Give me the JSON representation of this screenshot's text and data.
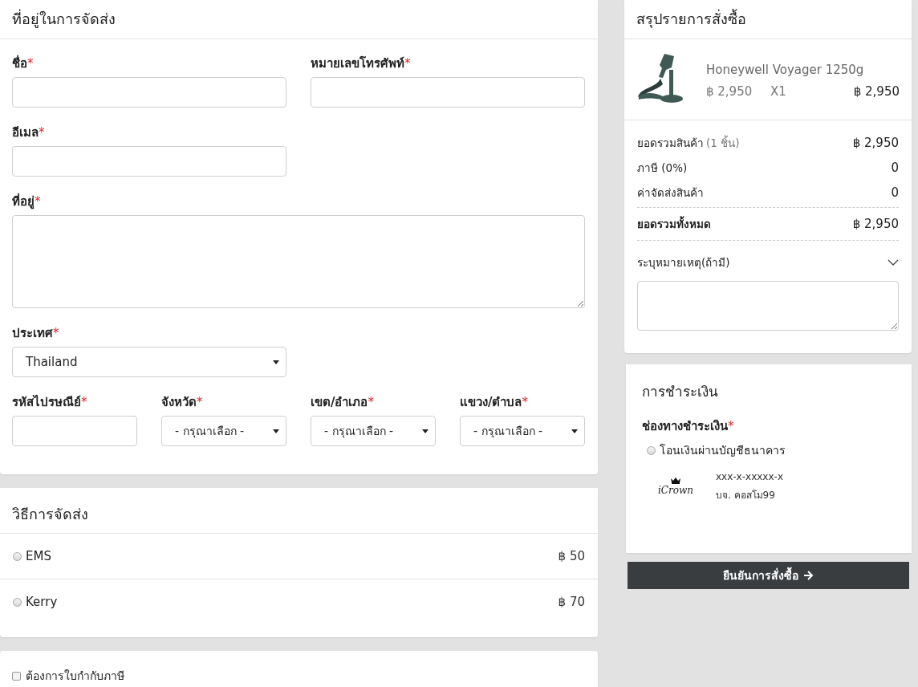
{
  "shipping_address": {
    "title": "ที่อยู่ในการจัดส่ง",
    "fields": [
      {
        "kind": "input",
        "label": "ชื่อ",
        "required_mark": "*"
      },
      {
        "kind": "input",
        "label": "หมายเลขโทรศัพท์",
        "required_mark": "*"
      },
      {
        "kind": "input",
        "label": "อีเมล",
        "required_mark": "*"
      },
      {
        "kind": "textarea",
        "label": "ที่อยู่",
        "required_mark": "*"
      },
      {
        "kind": "select",
        "label": "ประเทศ",
        "required_mark": "*",
        "value": "Thailand"
      }
    ],
    "region_fields": [
      {
        "kind": "input",
        "label": "รหัสไปรษณีย์",
        "required_mark": "*"
      },
      {
        "kind": "select",
        "label": "จังหวัด",
        "required_mark": "*",
        "value": "- กรุณาเลือก -"
      },
      {
        "kind": "select",
        "label": "เขต/อำเภอ",
        "required_mark": "*",
        "value": "- กรุณาเลือก -"
      },
      {
        "kind": "select",
        "label": "แขวง/ตำบล",
        "required_mark": "*",
        "value": "- กรุณาเลือก -"
      }
    ]
  },
  "shipping_methods": {
    "title": "วิธีการจัดส่ง",
    "options": [
      {
        "name": "EMS",
        "price": "฿ 50",
        "selected": false
      },
      {
        "name": "Kerry",
        "price": "฿ 70",
        "selected": false
      }
    ]
  },
  "tax_invoice": {
    "label": "ต้องการใบกำกับภาษี",
    "checked": false
  },
  "order_summary": {
    "title": "สรุปรายการสั่งซื้อ",
    "items": [
      {
        "name": "Honeywell Voyager 1250g",
        "unit_price": "฿ 2,950",
        "quantity": "X1",
        "total": "฿ 2,950"
      }
    ],
    "totals": [
      {
        "kind": "line",
        "label": "ยอดรวมสินค้า",
        "note": "(1 ชิ้น)",
        "value": "฿ 2,950"
      },
      {
        "kind": "line",
        "label": "ภาษี (0%)",
        "value": "0"
      },
      {
        "kind": "line",
        "label": "ค่าจัดส่งสินค้า",
        "value": "0"
      },
      {
        "kind": "grand",
        "label": "ยอดรวมทั้งหมด",
        "value": "฿ 2,950"
      }
    ],
    "remark": {
      "label": "ระบุหมายเหตุ(ถ้ามี)"
    }
  },
  "payment": {
    "title": "การชำระเงิน",
    "label": "ช่องทางชำระเงิน",
    "required_mark": "*",
    "options": [
      {
        "label": "โอนเงินผ่านบัญชีธนาคาร",
        "selected": false,
        "logo_text": "iCrown",
        "account_number": "xxx-x-xxxxx-x",
        "account_name": "บจ. คอสโม99"
      }
    ]
  },
  "confirm_button": {
    "label": "ยืนยันการสั่งซื้อ"
  }
}
